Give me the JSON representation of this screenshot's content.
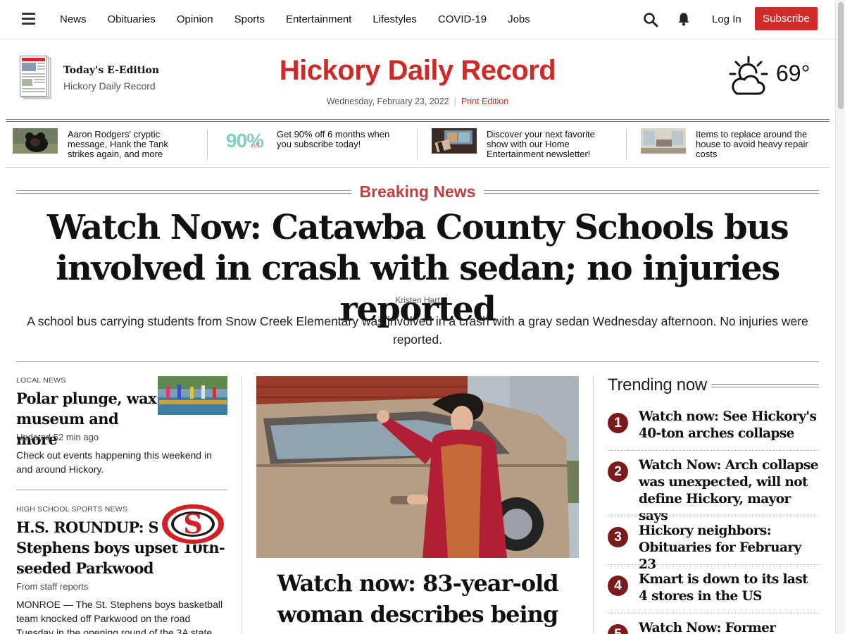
{
  "nav": {
    "items": [
      "News",
      "Obituaries",
      "Opinion",
      "Sports",
      "Entertainment",
      "Lifestyles",
      "COVID-19",
      "Jobs"
    ],
    "login": "Log In",
    "subscribe": "Subscribe",
    "accent": "#d12a2a"
  },
  "masthead": {
    "eedition_title": "Today's E-Edition",
    "eedition_sub": "Hickory Daily Record",
    "logo": "Hickory Daily Record",
    "date": "Wednesday, February 23, 2022",
    "separator": "|",
    "print_edition": "Print Edition",
    "temperature": "69°",
    "weather_icon": "partly-cloudy-sun-icon"
  },
  "promos": [
    {
      "text": "Aaron Rodgers' cryptic message, Hank the Tank strikes again, and more",
      "image": "bear-photo"
    },
    {
      "text": "Get 90% off 6 months when you subscribe today!",
      "image": "90-percent-off-graphic",
      "badge": "90%",
      "badge_sub": "off"
    },
    {
      "text": "Discover your next favorite show with our Home Entertainment newsletter!",
      "image": "tv-remote-photo"
    },
    {
      "text": "Items to replace around the house to avoid heavy repair costs",
      "image": "living-room-photo"
    }
  ],
  "breaking": {
    "label": "Breaking News",
    "headline": "Watch Now: Catawba County Schools bus involved in crash with sedan; no injuries reported",
    "byline": "Kristen Hart",
    "dek": "A school bus carrying students from Snow Creek Elementary was involved in a crash with a gray sedan Wednesday afternoon. No injuries were reported."
  },
  "left": [
    {
      "kicker": "LOCAL NEWS",
      "headline": "Polar plunge, wax museum and more",
      "meta": "Updated 52 min ago",
      "summary": "Check out events happening this weekend in and around Hickory."
    },
    {
      "kicker": "HIGH SCHOOL SPORTS NEWS",
      "headline": "H.S. ROUNDUP: St. Stephens boys upset 10th-seeded Parkwood",
      "meta": "From staff reports",
      "summary": "MONROE — The St. Stephens boys basketball team knocked off Parkwood on the road Tuesday in the opening round of the 3A state",
      "logo_letter": "S"
    }
  ],
  "center": {
    "headline": "Watch now: 83-year-old woman describes being"
  },
  "trending": {
    "title": "Trending now",
    "items": [
      {
        "num": "1",
        "text": "Watch now: See Hickory's 40-ton arches collapse"
      },
      {
        "num": "2",
        "text": "Watch Now: Arch collapse was unexpected, will not define Hickory, mayor says"
      },
      {
        "num": "3",
        "text": "Hickory neighbors: Obituaries for February 23"
      },
      {
        "num": "4",
        "text": "Kmart is down to its last 4 stores in the US"
      },
      {
        "num": "5",
        "text": "Watch Now: Former"
      }
    ]
  }
}
